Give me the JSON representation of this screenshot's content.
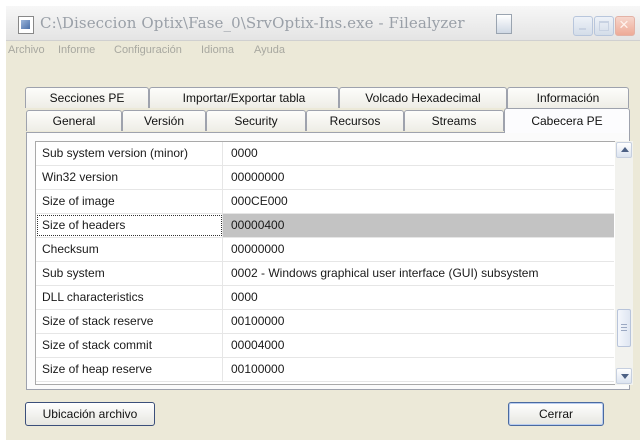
{
  "window": {
    "title": "C:\\Diseccion Optix\\Fase_0\\SrvOptix-Ins.exe - Filealyzer"
  },
  "menu": [
    "Archivo",
    "Informe",
    "Configuración",
    "Idioma",
    "Ayuda"
  ],
  "tabs_back": [
    "Secciones PE",
    "Importar/Exportar tabla",
    "Volcado Hexadecimal",
    "Información"
  ],
  "tabs_front": [
    "General",
    "Versión",
    "Security",
    "Recursos",
    "Streams",
    "Cabecera PE"
  ],
  "active_tab": "Cabecera PE",
  "rows": [
    {
      "key": "Sub system version (minor)",
      "value": "0000"
    },
    {
      "key": "Win32 version",
      "value": "00000000"
    },
    {
      "key": "Size of image",
      "value": "000CE000"
    },
    {
      "key": "Size of headers",
      "value": "00000400"
    },
    {
      "key": "Checksum",
      "value": "00000000"
    },
    {
      "key": "Sub system",
      "value": "0002 - Windows graphical user interface (GUI) subsystem"
    },
    {
      "key": "DLL characteristics",
      "value": "0000"
    },
    {
      "key": "Size of stack reserve",
      "value": "00100000"
    },
    {
      "key": "Size of stack commit",
      "value": "00004000"
    },
    {
      "key": "Size of heap reserve",
      "value": "00100000"
    }
  ],
  "selected_row": "Size of headers",
  "buttons": {
    "location": "Ubicación archivo",
    "close": "Cerrar"
  },
  "colors": {
    "window_bg": "#ece9d8",
    "selected_bg": "#c3c3c3",
    "inactive_title": "#9aa0a8"
  },
  "icons": [
    "app-icon",
    "document-icon",
    "minimize-icon",
    "maximize-icon",
    "close-icon",
    "scroll-up-icon",
    "scroll-down-icon"
  ]
}
